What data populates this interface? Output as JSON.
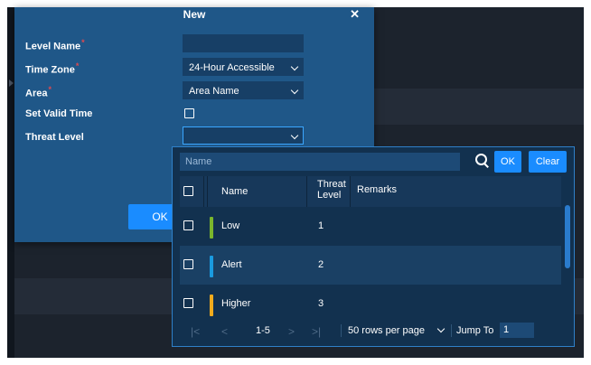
{
  "dialog": {
    "title": "New",
    "close_glyph": "✕",
    "fields": {
      "level_name": {
        "label": "Level Name",
        "value": "",
        "required": true
      },
      "time_zone": {
        "label": "Time Zone",
        "value": "24-Hour Accessible",
        "required": true
      },
      "area": {
        "label": "Area",
        "value": "Area Name",
        "required": true
      },
      "set_valid_time": {
        "label": "Set Valid Time",
        "checked": false
      },
      "threat_level": {
        "label": "Threat Level",
        "value": ""
      }
    },
    "required_mark": "*",
    "ok_label": "OK"
  },
  "dropdown": {
    "search_placeholder": "Name",
    "ok_label": "OK",
    "clear_label": "Clear",
    "columns": {
      "name": "Name",
      "threat_level_line1": "Threat",
      "threat_level_line2": "Level",
      "remarks": "Remarks"
    },
    "rows": [
      {
        "name": "Low",
        "level": "1",
        "remarks": "",
        "color": "#7ab62c"
      },
      {
        "name": "Alert",
        "level": "2",
        "remarks": "",
        "color": "#1a9be0"
      },
      {
        "name": "Higher",
        "level": "3",
        "remarks": "",
        "color": "#f0ab1d"
      }
    ],
    "pagination": {
      "range": "1-5",
      "rows_per_page": "50 rows per page",
      "jump_label": "Jump To",
      "jump_value": "1"
    }
  },
  "colors": {
    "accent": "#1a8cff",
    "dialog_bg": "#1f5788",
    "panel_bg": "#12314f"
  }
}
